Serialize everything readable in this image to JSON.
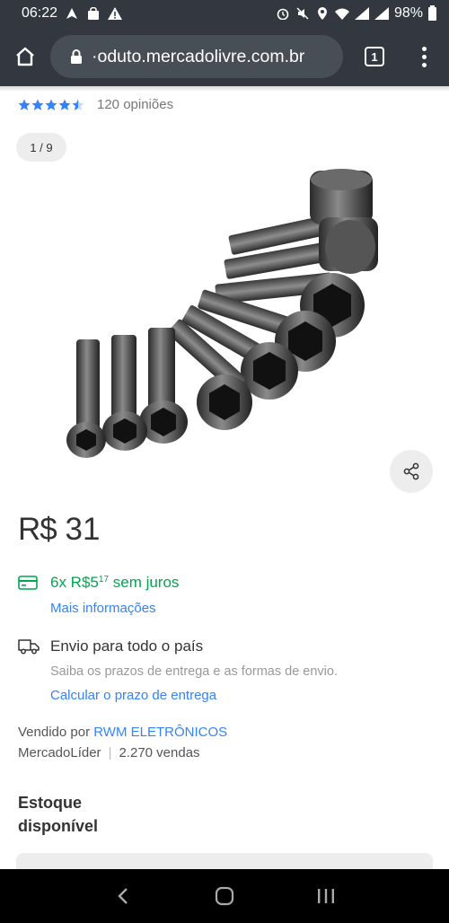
{
  "status_bar": {
    "time": "06:22",
    "battery": "98%"
  },
  "browser": {
    "url": "·oduto.mercadolivre.com.br",
    "tab_count": "1"
  },
  "product": {
    "rating_stars": 4.5,
    "reviews": "120 opiniões",
    "image_counter": "1 / 9",
    "price_currency": "R$",
    "price_value": "31"
  },
  "payment": {
    "inst_prefix": "6x R$",
    "inst_integer": "5",
    "inst_cents": "17",
    "inst_suffix": " sem juros",
    "more_info": "Mais informações"
  },
  "shipping": {
    "title": "Envio para todo o país",
    "subtitle": "Saiba os prazos de entrega e as formas de envio.",
    "link": "Calcular o prazo de entrega"
  },
  "seller": {
    "prefix": "Vendido por",
    "name": "RWM ELETRÔNICOS",
    "badge": "MercadoLíder",
    "sales": "2.270 vendas"
  },
  "stock": {
    "label": "Estoque disponível"
  },
  "colors": {
    "accent_blue": "#3483fa",
    "green": "#00a650",
    "chrome_dark": "#333840"
  }
}
